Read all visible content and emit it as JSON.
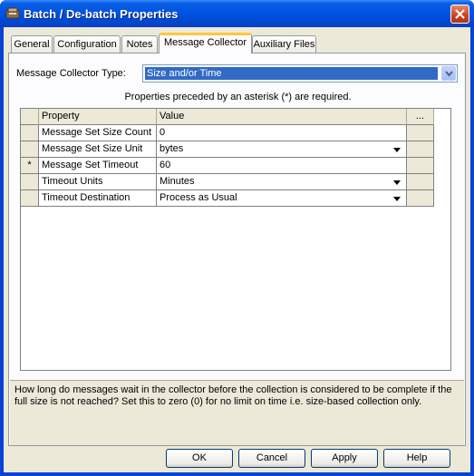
{
  "window": {
    "title": "Batch / De-batch Properties"
  },
  "tabs": [
    {
      "label": "General"
    },
    {
      "label": "Configuration"
    },
    {
      "label": "Notes"
    },
    {
      "label": "Message Collector"
    },
    {
      "label": "Auxiliary Files"
    }
  ],
  "active_tab": "Message Collector",
  "collector": {
    "type_label": "Message Collector Type:",
    "type_value": "Size and/or Time",
    "required_note": "Properties preceded by an asterisk (*) are required."
  },
  "grid": {
    "headers": {
      "property": "Property",
      "value": "Value",
      "more": "..."
    },
    "rows": [
      {
        "marker": "",
        "property": "Message Set Size Count",
        "value": "0",
        "dropdown": false
      },
      {
        "marker": "",
        "property": "Message Set Size Unit",
        "value": "bytes",
        "dropdown": true
      },
      {
        "marker": "*",
        "property": "Message Set Timeout",
        "value": "60",
        "dropdown": false
      },
      {
        "marker": "",
        "property": "Timeout Units",
        "value": "Minutes",
        "dropdown": true
      },
      {
        "marker": "",
        "property": "Timeout Destination",
        "value": "Process as Usual",
        "dropdown": true
      }
    ]
  },
  "description": "How long do messages wait in the collector before the collection is considered to be complete if the full size is not reached?  Set this to zero (0) for no limit on time i.e. size-based collection only.",
  "buttons": {
    "ok": "OK",
    "cancel": "Cancel",
    "apply": "Apply",
    "help": "Help"
  }
}
